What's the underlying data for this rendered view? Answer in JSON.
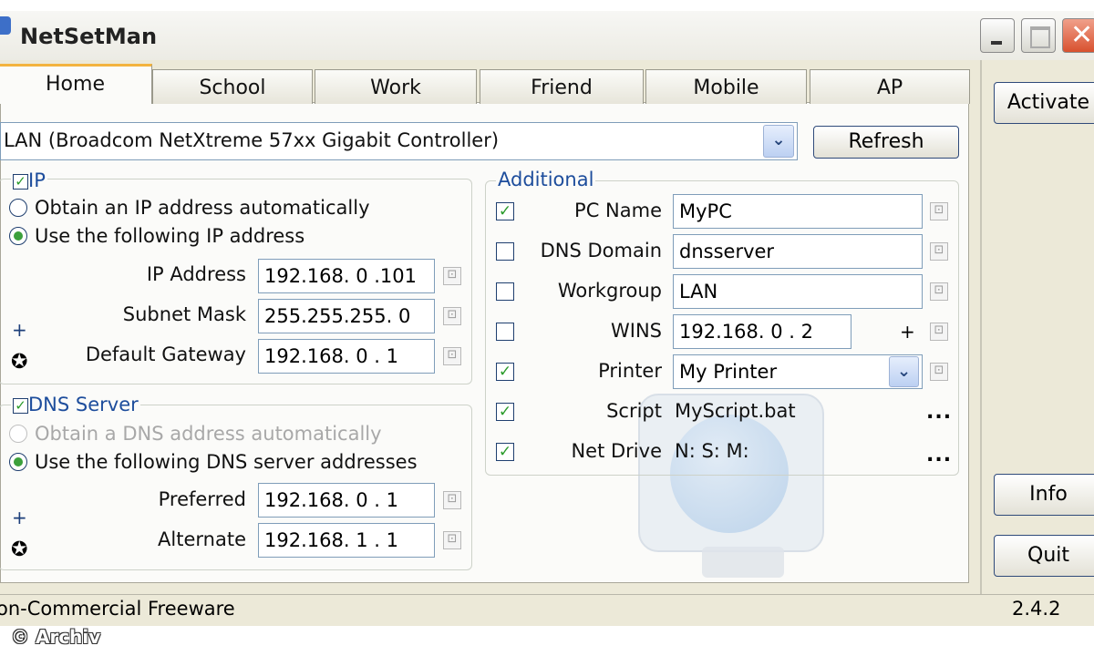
{
  "window": {
    "title": "NetSetMan"
  },
  "tabs": [
    "Home",
    "School",
    "Work",
    "Friend",
    "Mobile",
    "AP"
  ],
  "adapter": {
    "selected": "LAN (Broadcom NetXtreme 57xx Gigabit Controller)",
    "refresh_label": "Refresh"
  },
  "ip_group": {
    "legend": "IP",
    "enabled": true,
    "auto_label": "Obtain an IP address automatically",
    "manual_label": "Use the following IP address",
    "mode": "manual",
    "fields": [
      {
        "label": "IP Address",
        "value": "192.168. 0 .101"
      },
      {
        "label": "Subnet Mask",
        "value": "255.255.255. 0"
      },
      {
        "label": "Default Gateway",
        "value": "192.168. 0 . 1"
      }
    ],
    "add_symbol": "+",
    "gear_symbol": "✪"
  },
  "dns_group": {
    "legend": "DNS Server",
    "enabled": true,
    "auto_label": "Obtain a DNS address automatically",
    "manual_label": "Use the following DNS server addresses",
    "mode": "manual",
    "fields": [
      {
        "label": "Preferred",
        "value": "192.168. 0 . 1"
      },
      {
        "label": "Alternate",
        "value": "192.168. 1 . 1"
      }
    ],
    "add_symbol": "+",
    "gear_symbol": "✪"
  },
  "additional": {
    "legend": "Additional",
    "rows": [
      {
        "label": "PC Name",
        "checked": true,
        "value": "MyPC",
        "kind": "field"
      },
      {
        "label": "DNS Domain",
        "checked": false,
        "value": "dnsserver",
        "kind": "field"
      },
      {
        "label": "Workgroup",
        "checked": false,
        "value": "LAN",
        "kind": "field"
      },
      {
        "label": "WINS",
        "checked": false,
        "value": "192.168. 0 . 2",
        "kind": "field-plus",
        "extra": "+"
      },
      {
        "label": "Printer",
        "checked": true,
        "value": "My Printer",
        "kind": "select"
      },
      {
        "label": "Script",
        "checked": true,
        "value": "MyScript.bat",
        "kind": "text-dots",
        "extra": "..."
      },
      {
        "label": "Net Drive",
        "checked": true,
        "value": "N: S: M:",
        "kind": "text-dots",
        "extra": "..."
      }
    ]
  },
  "sidebar": {
    "activate_label": "Activate",
    "info_label": "Info",
    "quit_label": "Quit"
  },
  "status": {
    "left": "on-Commercial Freeware",
    "version": "2.4.2"
  },
  "copyright": "© Archiv",
  "icons": {
    "check": "✓",
    "dropdown": "⌄",
    "copy": "⊡"
  }
}
